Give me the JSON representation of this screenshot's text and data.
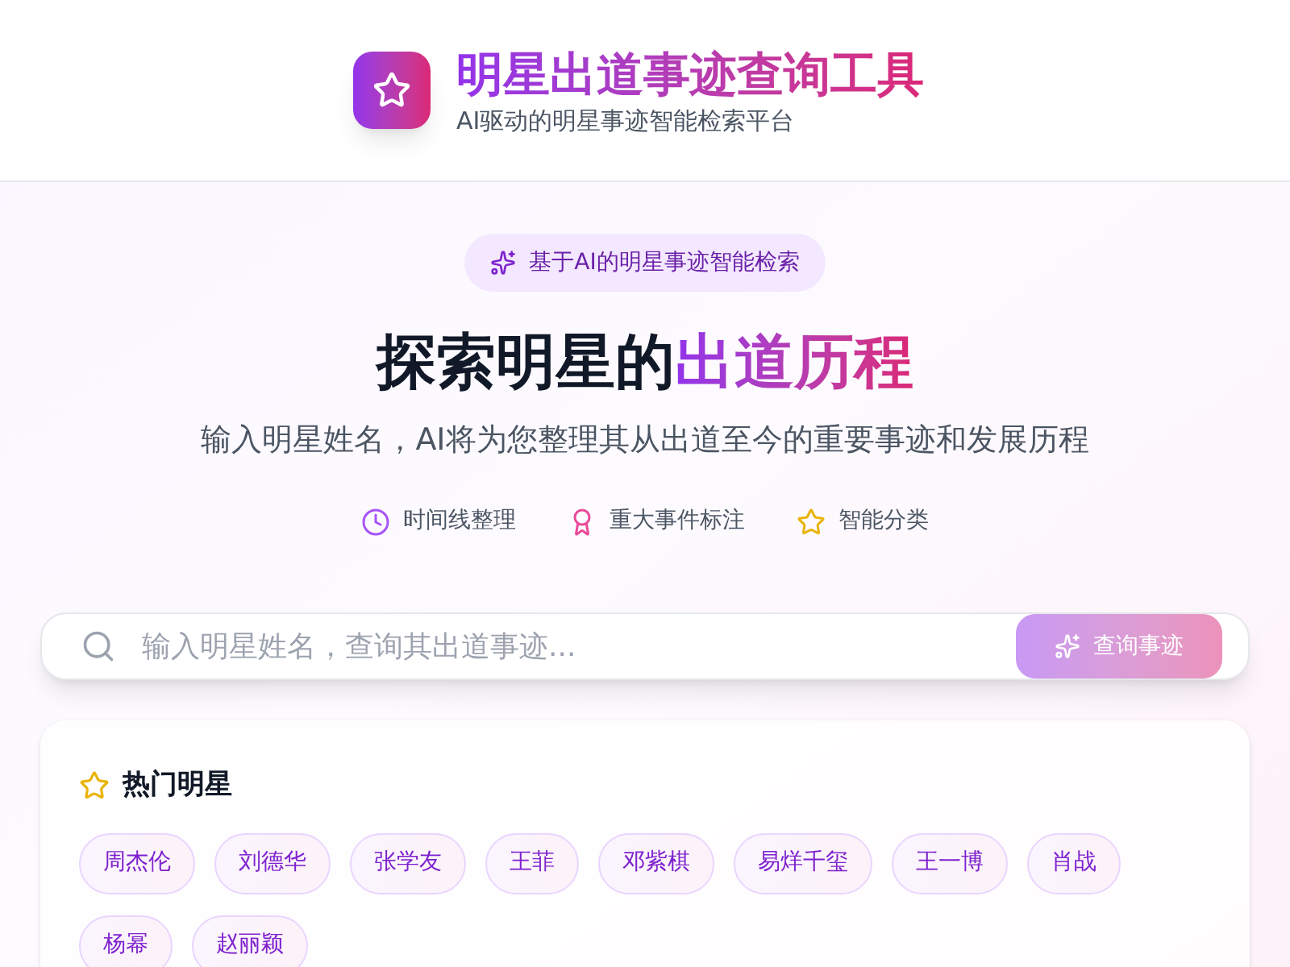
{
  "header": {
    "title": "明星出道事迹查询工具",
    "subtitle": "AI驱动的明星事迹智能检索平台"
  },
  "hero": {
    "badge": "基于AI的明星事迹智能检索",
    "title_lead": "探索明星的",
    "title_highlight": "出道历程",
    "description": "输入明星姓名，AI将为您整理其从出道至今的重要事迹和发展历程",
    "features": [
      {
        "kind": "clock",
        "label": "时间线整理"
      },
      {
        "kind": "award",
        "label": "重大事件标注"
      },
      {
        "kind": "star",
        "label": "智能分类"
      }
    ]
  },
  "search": {
    "placeholder": "输入明星姓名，查询其出道事迹...",
    "button": "查询事迹",
    "disabled": true
  },
  "popular": {
    "title": "热门明星",
    "names": [
      "周杰伦",
      "刘德华",
      "张学友",
      "王菲",
      "邓紫棋",
      "易烊千玺",
      "王一博",
      "肖战",
      "杨幂",
      "赵丽颖"
    ]
  }
}
